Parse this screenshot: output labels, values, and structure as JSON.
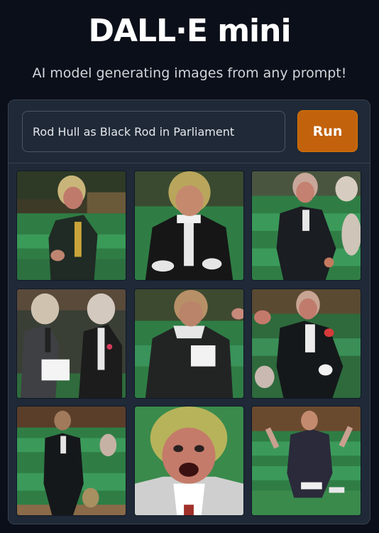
{
  "app": {
    "title": "DALL·E mini",
    "subtitle": "AI model generating images from any prompt!"
  },
  "prompt": {
    "value": "Rod Hull as Black Rod in Parliament"
  },
  "run_button": {
    "label": "Run"
  },
  "colors": {
    "background": "#0b0f19",
    "panel": "#1f2937",
    "accent": "#c2620c"
  },
  "gallery": {
    "images": [
      {
        "name": "generated-image-1"
      },
      {
        "name": "generated-image-2"
      },
      {
        "name": "generated-image-3"
      },
      {
        "name": "generated-image-4"
      },
      {
        "name": "generated-image-5"
      },
      {
        "name": "generated-image-6"
      },
      {
        "name": "generated-image-7"
      },
      {
        "name": "generated-image-8"
      },
      {
        "name": "generated-image-9"
      }
    ]
  }
}
